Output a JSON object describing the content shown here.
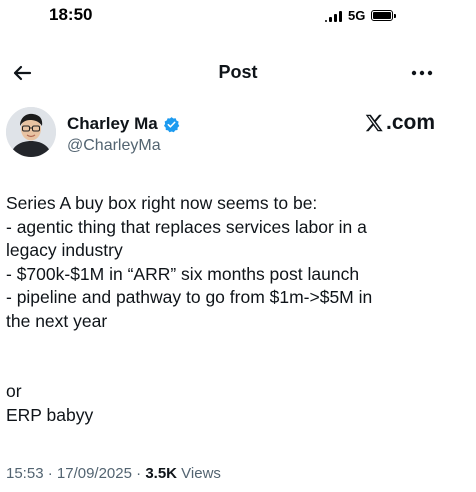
{
  "status_bar": {
    "time": "18:50",
    "network": "5G",
    "signal_icon": "cellular-signal-icon",
    "battery_icon": "battery-icon"
  },
  "nav": {
    "back_icon": "back-arrow-icon",
    "title": "Post",
    "more_icon": "more-dots-icon"
  },
  "author": {
    "name": "Charley Ma",
    "handle": "@CharleyMa",
    "verified_icon": "verified-badge-icon",
    "avatar_icon": "avatar"
  },
  "watermark": {
    "logo_icon": "x-logo-icon",
    "text": ".com"
  },
  "post": {
    "lines": [
      "Series A buy box right now seems to be:",
      "- agentic thing that replaces services labor in a",
      "legacy industry",
      "- $700k-$1M in “ARR” six months post launch",
      "- pipeline and pathway to go from $1m->$5M in",
      "the next year",
      "or",
      "ERP babyy"
    ]
  },
  "meta": {
    "time": "15:53",
    "separator": "·",
    "date": "17/09/2025",
    "views_count": "3.5K",
    "views_label": "Views"
  },
  "colors": {
    "text_primary": "#0f1419",
    "text_secondary": "#536471",
    "verified_blue": "#1d9bf0",
    "background": "#ffffff"
  }
}
